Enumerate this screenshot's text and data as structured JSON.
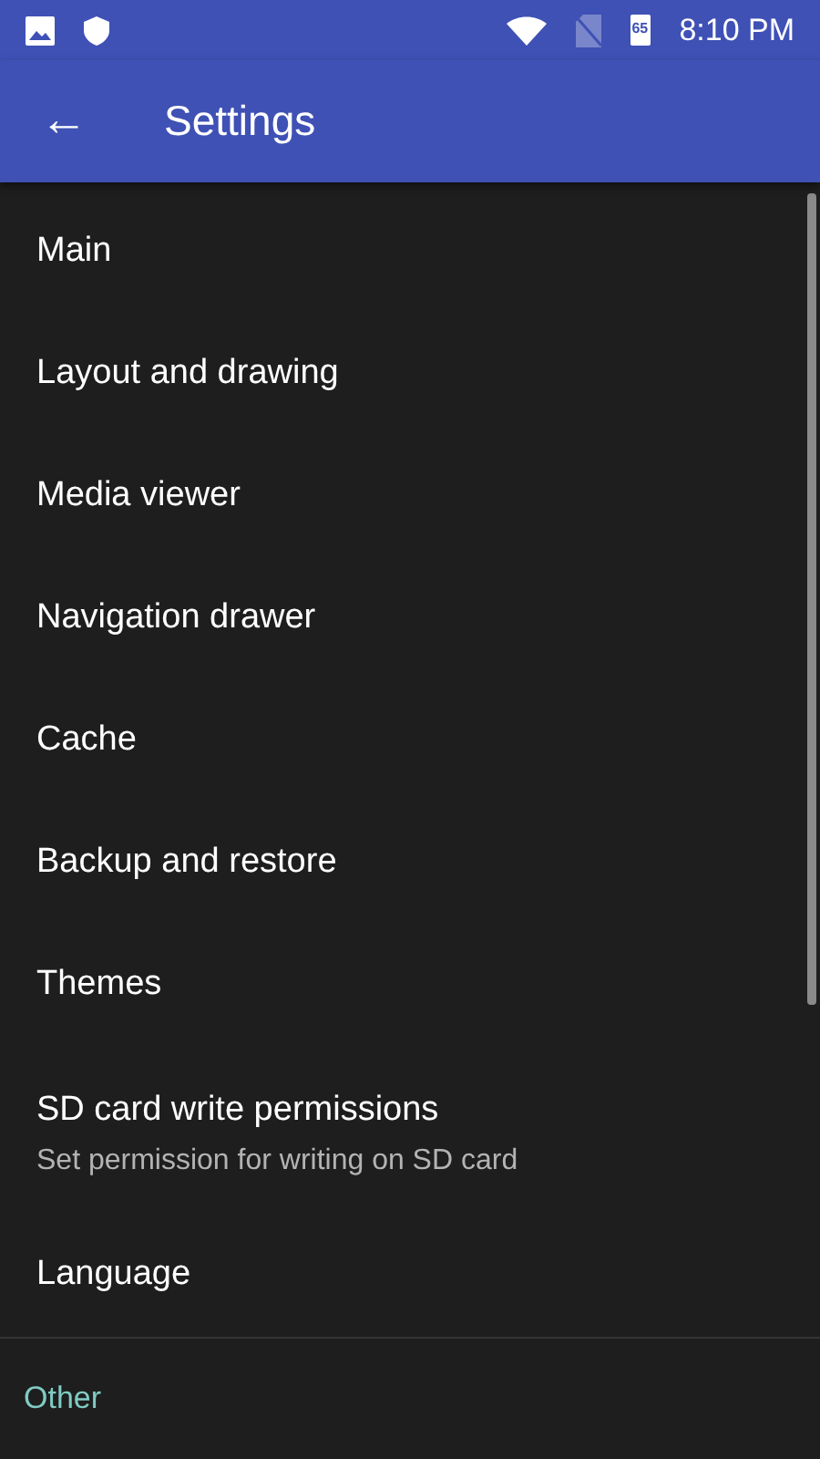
{
  "status_bar": {
    "battery_text": "65",
    "time": "8:10 PM"
  },
  "toolbar": {
    "back": "←",
    "title": "Settings"
  },
  "items": [
    {
      "title": "Main"
    },
    {
      "title": "Layout and drawing"
    },
    {
      "title": "Media viewer"
    },
    {
      "title": "Navigation drawer"
    },
    {
      "title": "Cache"
    },
    {
      "title": "Backup and restore"
    },
    {
      "title": "Themes"
    },
    {
      "title": "SD card write permissions",
      "summary": "Set permission for writing on SD card"
    },
    {
      "title": "Language"
    }
  ],
  "section": {
    "title": "Other"
  }
}
